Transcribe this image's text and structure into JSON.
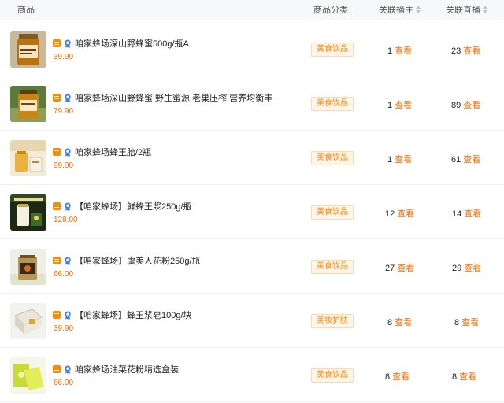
{
  "header": {
    "product": "商品",
    "category": "商品分类",
    "related_anchors": "关联播主",
    "related_lives": "关联直播"
  },
  "view_label": "查看",
  "rows": [
    {
      "title": "咱家蜂场深山野蜂蜜500g/瓶A",
      "price": "39.90",
      "category": "美食饮品",
      "anchors": "1",
      "lives": "23"
    },
    {
      "title": "咱家蜂场深山野蜂蜜 野生蜜源 老巢压榨 营养均衡丰",
      "price": "79.90",
      "category": "美食饮品",
      "anchors": "1",
      "lives": "89"
    },
    {
      "title": "咱家蜂场蜂王胎/2瓶",
      "price": "99.00",
      "category": "美食饮品",
      "anchors": "1",
      "lives": "61"
    },
    {
      "title": "【咱家蜂场】鲜蜂王浆250g/瓶",
      "price": "128.00",
      "category": "美食饮品",
      "anchors": "12",
      "lives": "14"
    },
    {
      "title": "【咱家蜂场】虞美人花粉250g/瓶",
      "price": "66.00",
      "category": "美食饮品",
      "anchors": "27",
      "lives": "29"
    },
    {
      "title": "【咱家蜂场】蜂王浆皂100g/块",
      "price": "39.90",
      "category": "美妆护肤",
      "anchors": "8",
      "lives": "8"
    },
    {
      "title": "咱家蜂场油菜花粉精选盒装",
      "price": "66.00",
      "category": "美食饮品",
      "anchors": "8",
      "lives": "8"
    }
  ],
  "icons": {
    "shop": "shop-icon",
    "badge": "verified-badge-icon",
    "sort": "sort-icon"
  },
  "colors": {
    "accent": "#ff6a00",
    "tag_bg": "#fff6e9",
    "tag_border": "#ffd9a6",
    "shop_icon": "#ff8a00",
    "badge": "#3f7ee8"
  }
}
